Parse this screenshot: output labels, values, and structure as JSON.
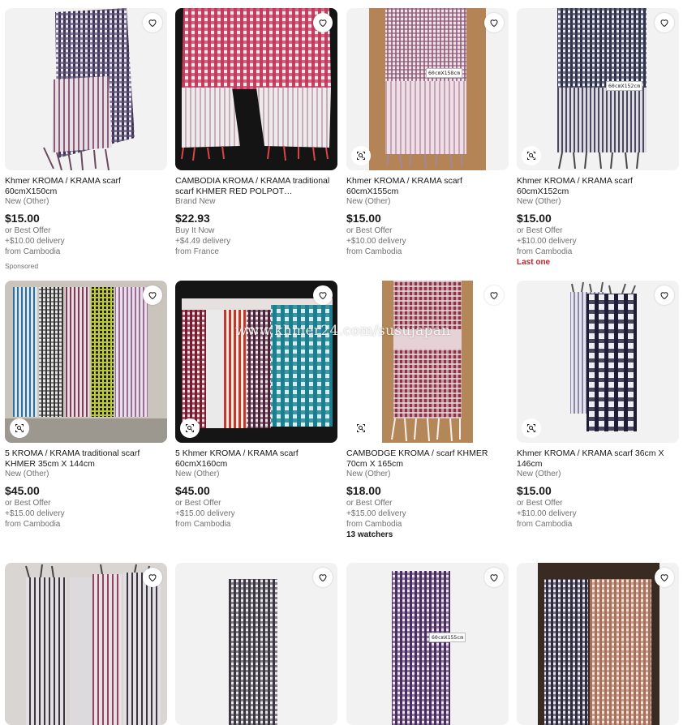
{
  "listings": [
    {
      "title": "Khmer KROMA / KRAMA scarf 60cmX150cm",
      "condition": "New (Other)",
      "price": "$15.00",
      "purchase": "or Best Offer",
      "shipping": "+$10.00 delivery",
      "location": "from Cambodia",
      "extra": ""
    },
    {
      "title": "CAMBODIA KROMA / KRAMA traditional scarf KHMER RED POLPOT CAMBODIA...",
      "condition": "Brand New",
      "price": "$22.93",
      "purchase": "Buy It Now",
      "shipping": "+$4.49 delivery",
      "location": "from France",
      "extra": ""
    },
    {
      "title": "Khmer KROMA / KRAMA scarf 60cmX155cm",
      "condition": "New (Other)",
      "price": "$15.00",
      "purchase": "or Best Offer",
      "shipping": "+$10.00 delivery",
      "location": "from Cambodia",
      "extra": ""
    },
    {
      "title": "Khmer KROMA / KRAMA scarf 60cmX152cm",
      "condition": "New (Other)",
      "price": "$15.00",
      "purchase": "or Best Offer",
      "shipping": "+$10.00 delivery",
      "location": "from Cambodia",
      "extra": "Last one"
    },
    {
      "title": "5 KROMA / KRAMA traditional scarf KHMER 35cm X 144cm",
      "condition": "New (Other)",
      "price": "$45.00",
      "purchase": "or Best Offer",
      "shipping": "+$15.00 delivery",
      "location": "from Cambodia",
      "extra": ""
    },
    {
      "title": "5 Khmer KROMA / KRAMA scarf 60cmX160cm",
      "condition": "New (Other)",
      "price": "$45.00",
      "purchase": "or Best Offer",
      "shipping": "+$15.00 delivery",
      "location": "from Cambodia",
      "extra": ""
    },
    {
      "title": "CAMBODGE KROMA / scarf KHMER 70cm X 165cm",
      "condition": "New (Other)",
      "price": "$18.00",
      "purchase": "or Best Offer",
      "shipping": "+$15.00 delivery",
      "location": "from Cambodia",
      "extra": "13 watchers"
    },
    {
      "title": "Khmer KROMA / KRAMA scarf 36cm X 146cm",
      "condition": "New (Other)",
      "price": "$15.00",
      "purchase": "or Best Offer",
      "shipping": "+$10.00 delivery",
      "location": "from Cambodia",
      "extra": ""
    }
  ],
  "sponsored_label": "Sponsored",
  "watermark": "www.khmer24.com/susujapan",
  "photo_tags": {
    "p3": "60cmX158cm",
    "p4": "60cmX152cm",
    "p11": "60cmX155cm"
  },
  "icons": {
    "favorite": "heart-icon",
    "visual_search": "camera-search-icon"
  },
  "colors": {
    "price": "#191919",
    "muted": "#707070",
    "last_one": "#c0242a",
    "card_bg": "#f2f2f2"
  }
}
